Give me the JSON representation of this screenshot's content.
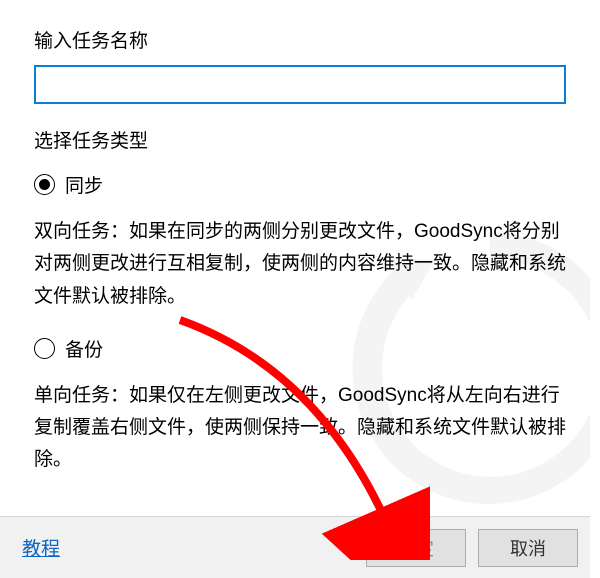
{
  "labels": {
    "task_name_title": "输入任务名称",
    "task_type_title": "选择任务类型"
  },
  "input": {
    "task_name_value": ""
  },
  "options": {
    "sync": {
      "label": "同步",
      "desc": "双向任务：如果在同步的两侧分别更改文件，GoodSync将分别对两侧更改进行互相复制，使两侧的内容维持一致。隐藏和系统文件默认被排除。",
      "selected": true
    },
    "backup": {
      "label": "备份",
      "desc": "单向任务：如果仅在左侧更改文件，GoodSync将从左向右进行复制覆盖右侧文件，使两侧保持一致。隐藏和系统文件默认被排除。",
      "selected": false
    }
  },
  "footer": {
    "tutorial": "教程",
    "ok": "确定",
    "cancel": "取消"
  },
  "colors": {
    "accent": "#0a7fd6",
    "link": "#0a66c2",
    "arrow": "#ff0000"
  }
}
